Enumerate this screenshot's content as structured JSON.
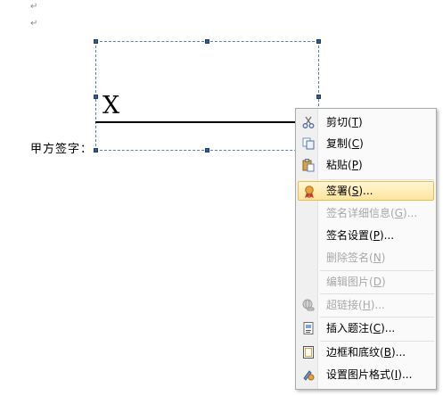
{
  "document": {
    "paragraph_mark": "↵",
    "signer_label": "甲方签字：",
    "signature_x": "X"
  },
  "context_menu": {
    "items": [
      {
        "id": "cut",
        "label": "剪切",
        "key": "T",
        "icon": "scissors-icon",
        "enabled": true
      },
      {
        "id": "copy",
        "label": "复制",
        "key": "C",
        "icon": "copy-icon",
        "enabled": true
      },
      {
        "id": "paste",
        "label": "粘贴",
        "key": "P",
        "icon": "paste-icon",
        "enabled": true
      },
      {
        "id": "sign",
        "label": "签署",
        "key": "S",
        "suffix": "...",
        "icon": "signature-ribbon-icon",
        "enabled": true,
        "highlighted": true
      },
      {
        "id": "sig-details",
        "label": "签名详细信息",
        "key": "G",
        "suffix": "...",
        "enabled": false
      },
      {
        "id": "sig-setup",
        "label": "签名设置",
        "key": "P",
        "suffix": "...",
        "enabled": true
      },
      {
        "id": "remove-sig",
        "label": "删除签名",
        "key": "N",
        "enabled": false
      },
      {
        "id": "edit-picture",
        "label": "编辑图片",
        "key": "D",
        "enabled": false
      },
      {
        "id": "hyperlink",
        "label": "超链接",
        "key": "H",
        "suffix": "...",
        "icon": "globe-icon",
        "enabled": false
      },
      {
        "id": "insert-caption",
        "label": "插入题注",
        "key": "C",
        "suffix": "...",
        "icon": "caption-icon",
        "enabled": true
      },
      {
        "id": "borders",
        "label": "边框和底纹",
        "key": "B",
        "suffix": "...",
        "icon": "page-border-icon",
        "enabled": true
      },
      {
        "id": "format-picture",
        "label": "设置图片格式",
        "key": "I",
        "suffix": "...",
        "icon": "format-picture-icon",
        "enabled": true
      }
    ]
  }
}
